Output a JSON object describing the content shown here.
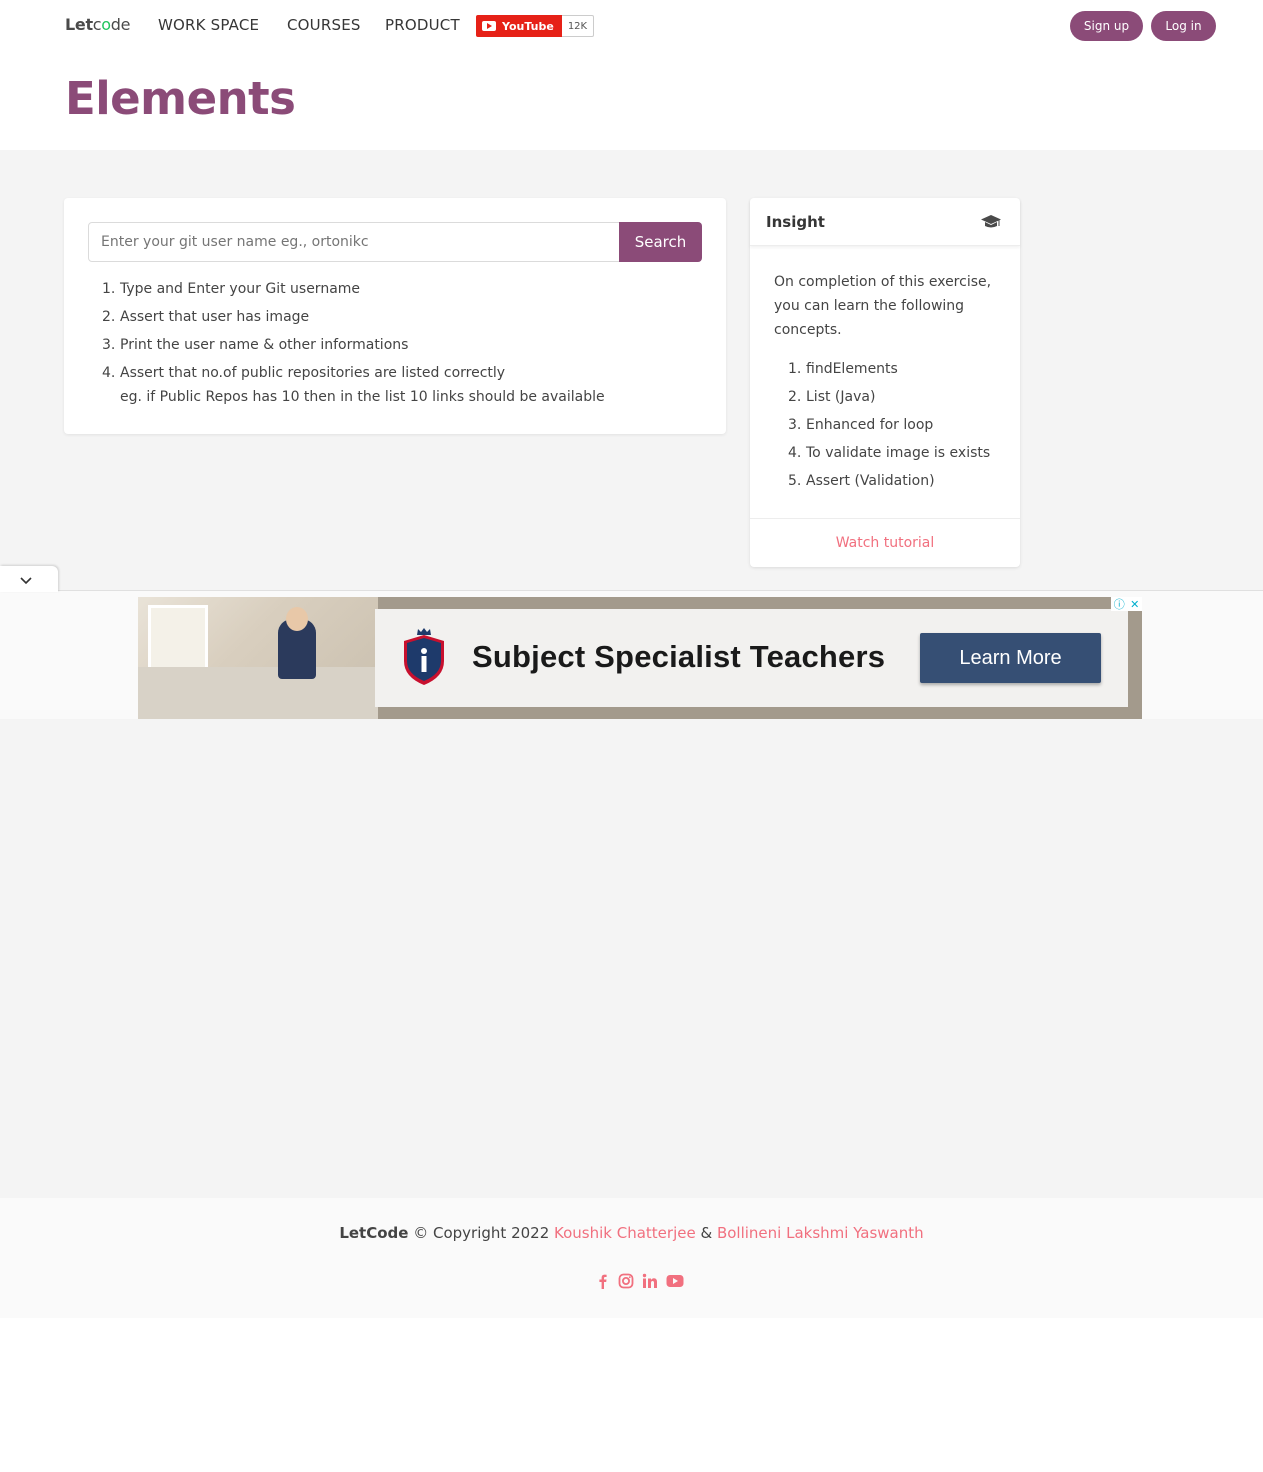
{
  "nav": {
    "logo_let": "Let",
    "logo_c": "c",
    "logo_o": "o",
    "logo_de": "de",
    "items": [
      "WORK SPACE",
      "COURSES",
      "PRODUCT"
    ],
    "youtube_label": "YouTube",
    "youtube_count": "12K",
    "signup": "Sign up",
    "login": "Log in"
  },
  "page": {
    "title": "Elements"
  },
  "search": {
    "placeholder": "Enter your git user name eg., ortonikc",
    "button": "Search"
  },
  "steps": [
    {
      "num": "1.",
      "text": "Type and Enter your Git username"
    },
    {
      "num": "2.",
      "text": "Assert that user has image"
    },
    {
      "num": "3.",
      "text": "Print the user name & other informations"
    },
    {
      "num": "4.",
      "text": "Assert that no.of public repositories are listed correctly"
    }
  ],
  "steps_note": "eg. if Public Repos has 10 then in the list 10 links should be available",
  "insight": {
    "title": "Insight",
    "text": "On completion of this exercise, you can learn the following concepts.",
    "concepts": [
      {
        "num": "1.",
        "text": "findElements"
      },
      {
        "num": "2.",
        "text": "List (Java)"
      },
      {
        "num": "3.",
        "text": "Enhanced for loop"
      },
      {
        "num": "4.",
        "text": "To validate image is exists"
      },
      {
        "num": "5.",
        "text": "Assert (Validation)"
      }
    ],
    "footer_link": "Watch tutorial",
    "icon": "graduation-cap-icon"
  },
  "ad": {
    "headline": "Subject Specialist Teachers",
    "cta": "Learn More"
  },
  "footer": {
    "brand": "LetCode",
    "copyright": " © Copyright 2022 ",
    "author1": "Koushik Chatterjee",
    "amp": " & ",
    "author2": "Bollineni Lakshmi Yaswanth",
    "social_icons": [
      "facebook-icon",
      "instagram-icon",
      "linkedin-icon",
      "youtube-icon"
    ]
  },
  "colors": {
    "brand": "#8b4b78",
    "link": "#f1707f",
    "background_gray": "#f4f4f4"
  }
}
